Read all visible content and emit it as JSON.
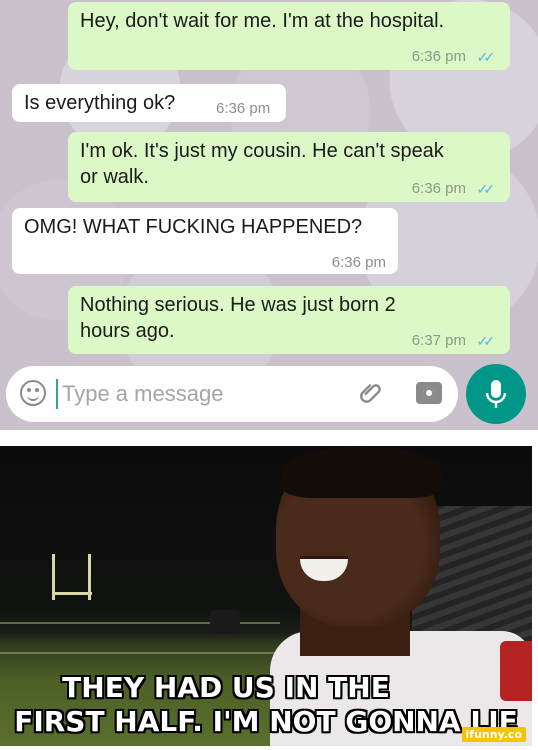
{
  "chat": {
    "messages": [
      {
        "direction": "outgoing",
        "text": "Hey, don't wait for me. I'm at the hospital.",
        "time": "6:36 pm"
      },
      {
        "direction": "incoming",
        "text": "Is everything ok?",
        "time": "6:36 pm"
      },
      {
        "direction": "outgoing",
        "text_line1": "I'm ok. It's just my cousin. He can't speak",
        "text_line2": "or walk.",
        "time": "6:36 pm"
      },
      {
        "direction": "incoming",
        "text": "OMG! WHAT FUCKING HAPPENED?",
        "time": "6:36 pm"
      },
      {
        "direction": "outgoing",
        "text_line1": "Nothing serious. He was just born 2",
        "text_line2": "hours ago.",
        "time": "6:37 pm"
      }
    ],
    "input": {
      "placeholder": "Type a message"
    },
    "icons": {
      "emoji": "emoji-icon",
      "attach": "paperclip-icon",
      "camera": "camera-icon",
      "mic": "microphone-icon"
    },
    "colors": {
      "outgoing_bubble": "#dcf8c6",
      "incoming_bubble": "#ffffff",
      "read_ticks": "#4fb6ec",
      "mic_button": "#009688"
    }
  },
  "meme": {
    "caption_line1": "THEY HAD US IN THE",
    "caption_line2": "FIRST HALF. I'M NOT GONNA LIE",
    "watermark": "ifunny.co"
  }
}
